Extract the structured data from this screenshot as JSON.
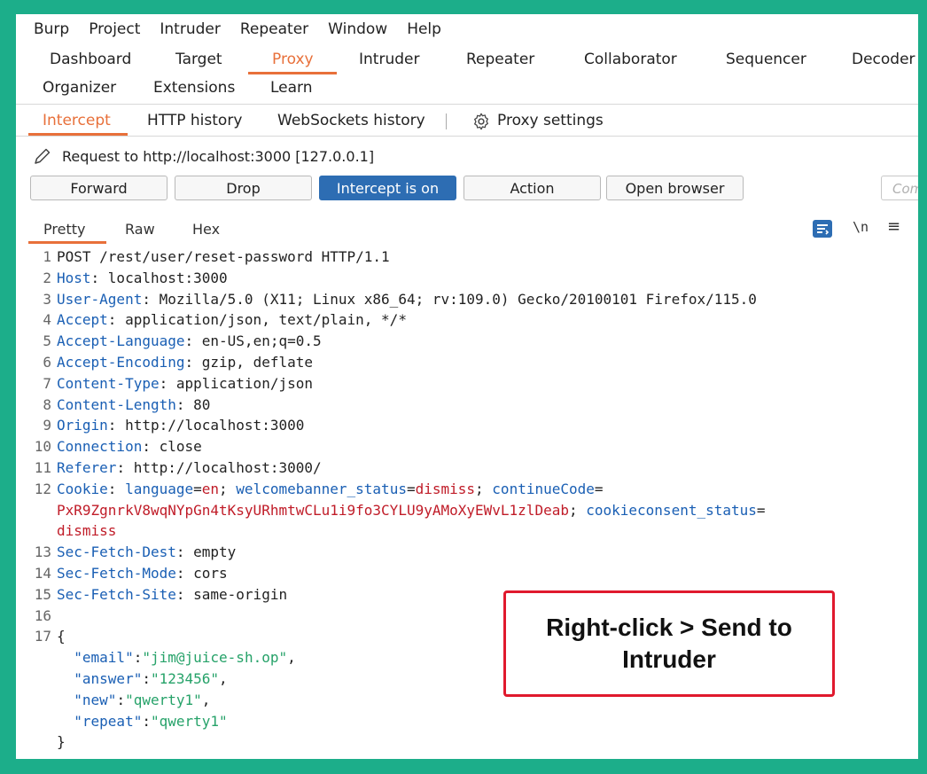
{
  "menu": [
    "Burp",
    "Project",
    "Intruder",
    "Repeater",
    "Window",
    "Help"
  ],
  "main_tabs_row1": [
    "Dashboard",
    "Target",
    "Proxy",
    "Intruder",
    "Repeater",
    "Collaborator",
    "Sequencer",
    "Decoder"
  ],
  "main_tabs_row2": [
    "Organizer",
    "Extensions",
    "Learn"
  ],
  "proxy_tabs": {
    "intercept": "Intercept",
    "http_history": "HTTP history",
    "websockets_history": "WebSockets history",
    "proxy_settings": "Proxy settings"
  },
  "request_target": "Request to http://localhost:3000  [127.0.0.1]",
  "buttons": {
    "forward": "Forward",
    "drop": "Drop",
    "intercept": "Intercept is on",
    "action": "Action",
    "open_browser": "Open browser",
    "comment_placeholder": "Com"
  },
  "view_tabs": {
    "pretty": "Pretty",
    "raw": "Raw",
    "hex": "Hex",
    "newline_toggle": "\\n",
    "menu": "≡"
  },
  "request": {
    "line_numbers": [
      "1",
      "2",
      "3",
      "4",
      "5",
      "6",
      "7",
      "8",
      "9",
      "10",
      "11",
      "12",
      "",
      "",
      "13",
      "14",
      "15",
      "16",
      "17",
      "",
      "",
      "",
      "",
      ""
    ],
    "lines": [
      {
        "plain": "POST /rest/user/reset-password HTTP/1.1"
      },
      {
        "key": "Host",
        "value": " localhost:3000"
      },
      {
        "key": "User-Agent",
        "value": " Mozilla/5.0 (X11; Linux x86_64; rv:109.0) Gecko/20100101 Firefox/115.0"
      },
      {
        "key": "Accept",
        "value": " application/json, text/plain, */*"
      },
      {
        "key": "Accept-Language",
        "value": " en-US,en;q=0.5"
      },
      {
        "key": "Accept-Encoding",
        "value": " gzip, deflate"
      },
      {
        "key": "Content-Type",
        "value": " application/json"
      },
      {
        "key": "Content-Length",
        "value": " 80"
      },
      {
        "key": "Origin",
        "value": " http://localhost:3000"
      },
      {
        "key": "Connection",
        "value": " close"
      },
      {
        "key": "Referer",
        "value": " http://localhost:3000/"
      }
    ],
    "cookie": {
      "key": "Cookie",
      "c1_name": "language",
      "c1_value": "en",
      "c2_name": "welcomebanner_status",
      "c2_value": "dismiss",
      "c3_name": "continueCode",
      "c3_value": "PxR9ZgnrkV8wqNYpGn4tKsyURhmtwCLu1i9fo3CYLU9yAMoXyEWvL1zlDeab",
      "c4_name": "cookieconsent_status",
      "c4_value": "dismiss"
    },
    "lines_after": [
      {
        "key": "Sec-Fetch-Dest",
        "value": " empty"
      },
      {
        "key": "Sec-Fetch-Mode",
        "value": " cors"
      },
      {
        "key": "Sec-Fetch-Site",
        "value": " same-origin"
      }
    ],
    "body": {
      "open": "{",
      "email_key": "\"email\"",
      "email_val": "\"jim@juice-sh.op\"",
      "answer_key": "\"answer\"",
      "answer_val": "\"123456\"",
      "new_key": "\"new\"",
      "new_val": "\"qwerty1\"",
      "repeat_key": "\"repeat\"",
      "repeat_val": "\"qwerty1\"",
      "close": "}"
    }
  },
  "callout": {
    "line1": "Right-click > Send to",
    "line2": "Intruder"
  },
  "colors": {
    "accent": "#e8703a",
    "button_on": "#2d6db3",
    "header_key": "#1a5fb4",
    "cookie_value": "#c01c28",
    "json_string": "#26a269",
    "callout_border": "#e0192d",
    "frame": "#1cae8a"
  }
}
